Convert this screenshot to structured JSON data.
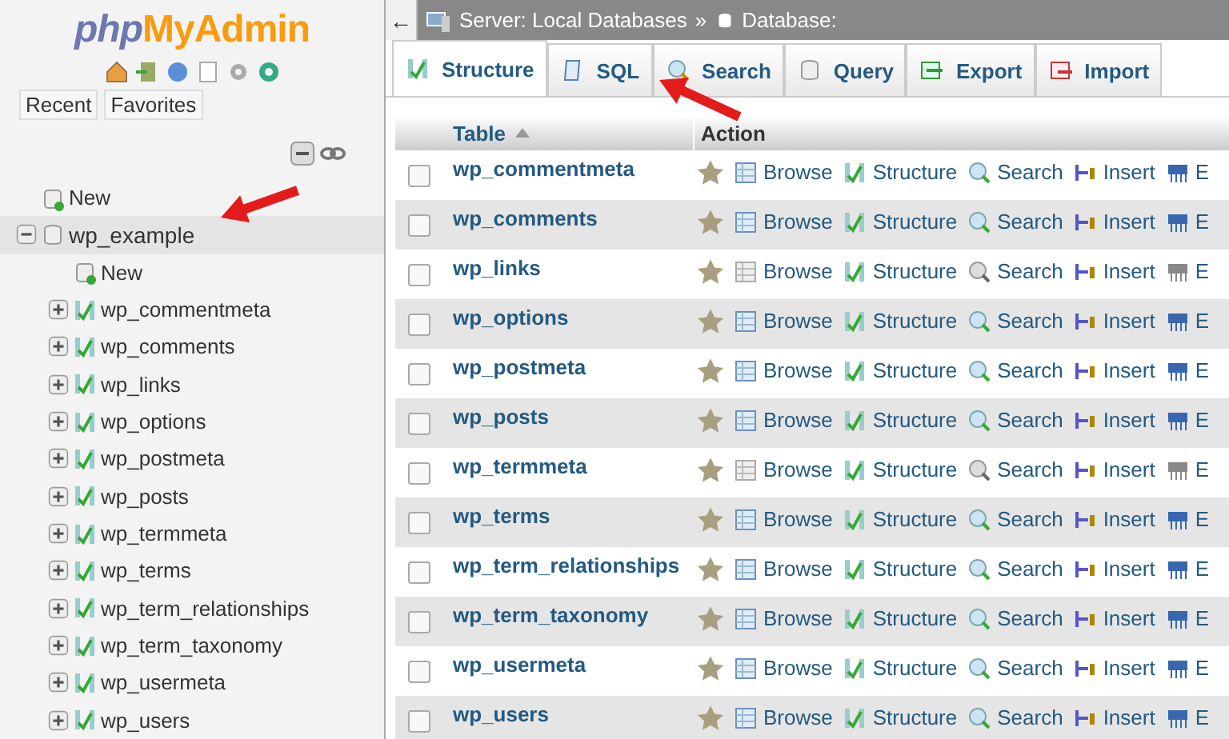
{
  "sidebar": {
    "logo": {
      "part_1": "php",
      "part_2": "MyAdmin"
    },
    "tabs": [
      {
        "label": "Recent"
      },
      {
        "label": "Favorites"
      }
    ],
    "tree": [
      {
        "label": "New",
        "kind": "new"
      },
      {
        "label": "wp_example",
        "kind": "database",
        "expanded": true,
        "highlighted": true,
        "children": [
          {
            "label": "New",
            "kind": "new"
          },
          {
            "label": "wp_commentmeta",
            "kind": "table",
            "expanded": false
          },
          {
            "label": "wp_comments",
            "kind": "table",
            "expanded": false
          },
          {
            "label": "wp_links",
            "kind": "table",
            "expanded": false
          },
          {
            "label": "wp_options",
            "kind": "table",
            "expanded": false
          },
          {
            "label": "wp_postmeta",
            "kind": "table",
            "expanded": false
          },
          {
            "label": "wp_posts",
            "kind": "table",
            "expanded": false
          },
          {
            "label": "wp_termmeta",
            "kind": "table",
            "expanded": false
          },
          {
            "label": "wp_terms",
            "kind": "table",
            "expanded": false
          },
          {
            "label": "wp_term_relationships",
            "kind": "table",
            "expanded": false
          },
          {
            "label": "wp_term_taxonomy",
            "kind": "table",
            "expanded": false
          },
          {
            "label": "wp_usermeta",
            "kind": "table",
            "expanded": false
          },
          {
            "label": "wp_users",
            "kind": "table",
            "expanded": false
          }
        ]
      }
    ]
  },
  "breadcrumb": {
    "back": "←",
    "server": "Server: Local Databases",
    "separator": "»",
    "database": "Database:"
  },
  "tabs": [
    {
      "label": "Structure",
      "kind": "structure",
      "selected": true
    },
    {
      "label": "SQL",
      "kind": "sql",
      "selected": false
    },
    {
      "label": "Search",
      "kind": "search",
      "selected": false
    },
    {
      "label": "Query",
      "kind": "query",
      "selected": false
    },
    {
      "label": "Export",
      "kind": "export",
      "selected": false
    },
    {
      "label": "Import",
      "kind": "import",
      "selected": false
    }
  ],
  "table": {
    "columns": [
      "Table",
      "Action"
    ],
    "rows": [
      {
        "name": "wp_commentmeta",
        "checked": false,
        "empty": false,
        "actions": [
          "Browse",
          "Structure",
          "Search",
          "Insert",
          "E"
        ]
      },
      {
        "name": "wp_comments",
        "checked": false,
        "empty": false,
        "actions": [
          "Browse",
          "Structure",
          "Search",
          "Insert",
          "E"
        ]
      },
      {
        "name": "wp_links",
        "checked": false,
        "empty": true,
        "actions": [
          "Browse",
          "Structure",
          "Search",
          "Insert",
          "E"
        ]
      },
      {
        "name": "wp_options",
        "checked": false,
        "empty": false,
        "actions": [
          "Browse",
          "Structure",
          "Search",
          "Insert",
          "E"
        ]
      },
      {
        "name": "wp_postmeta",
        "checked": false,
        "empty": false,
        "actions": [
          "Browse",
          "Structure",
          "Search",
          "Insert",
          "E"
        ]
      },
      {
        "name": "wp_posts",
        "checked": false,
        "empty": false,
        "actions": [
          "Browse",
          "Structure",
          "Search",
          "Insert",
          "E"
        ]
      },
      {
        "name": "wp_termmeta",
        "checked": false,
        "empty": true,
        "actions": [
          "Browse",
          "Structure",
          "Search",
          "Insert",
          "E"
        ]
      },
      {
        "name": "wp_terms",
        "checked": false,
        "empty": false,
        "actions": [
          "Browse",
          "Structure",
          "Search",
          "Insert",
          "E"
        ]
      },
      {
        "name": "wp_term_relationships",
        "checked": false,
        "empty": false,
        "actions": [
          "Browse",
          "Structure",
          "Search",
          "Insert",
          "E"
        ]
      },
      {
        "name": "wp_term_taxonomy",
        "checked": false,
        "empty": false,
        "actions": [
          "Browse",
          "Structure",
          "Search",
          "Insert",
          "E"
        ]
      },
      {
        "name": "wp_usermeta",
        "checked": false,
        "empty": false,
        "actions": [
          "Browse",
          "Structure",
          "Search",
          "Insert",
          "E"
        ]
      },
      {
        "name": "wp_users",
        "checked": false,
        "empty": false,
        "actions": [
          "Browse",
          "Structure",
          "Search",
          "Insert",
          "E"
        ]
      }
    ]
  }
}
